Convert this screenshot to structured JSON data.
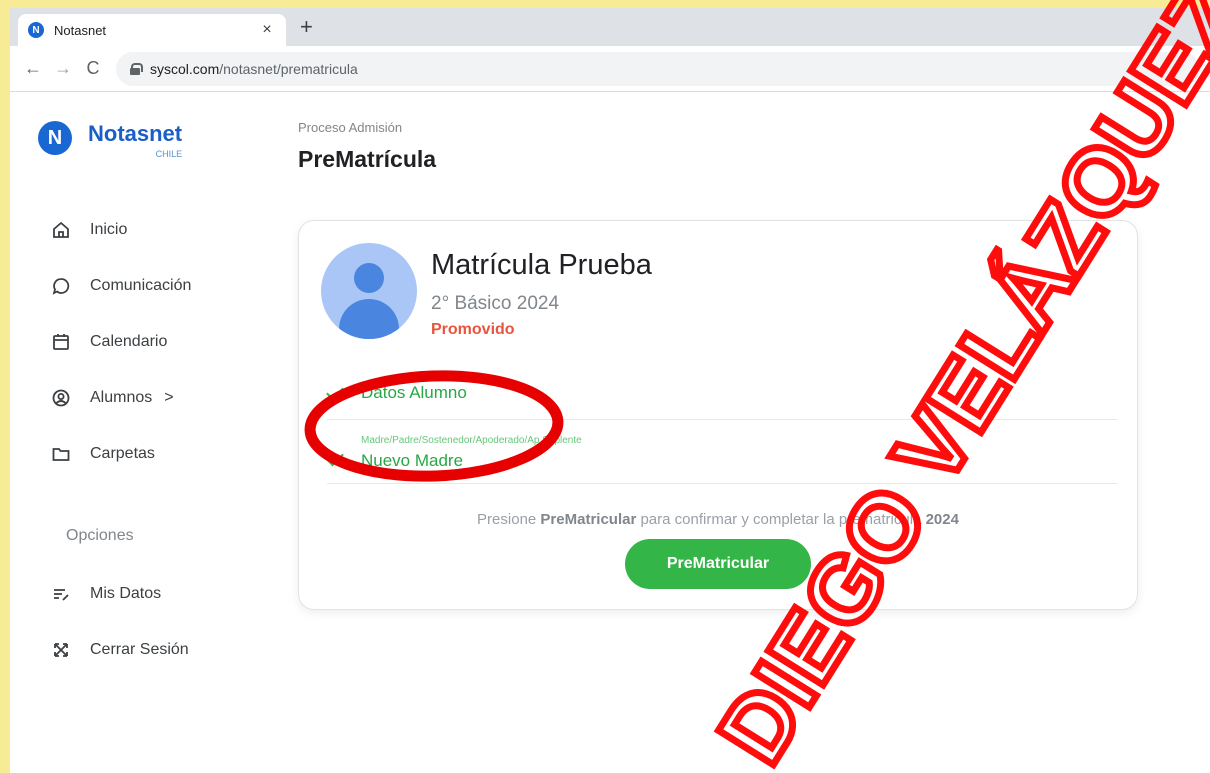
{
  "browser": {
    "tab_title": "Notasnet",
    "tab_close": "×",
    "new_tab": "+",
    "back": "←",
    "forward": "→",
    "reload": "C",
    "url_host": "syscol.com",
    "url_path": "/notasnet/prematricula"
  },
  "brand": {
    "logo_letter": "N",
    "name": "Notasnet",
    "country": "CHILE"
  },
  "sidebar": {
    "items": [
      {
        "label": "Inicio",
        "icon": "home-icon"
      },
      {
        "label": "Comunicación",
        "icon": "chat-bubble-icon"
      },
      {
        "label": "Calendario",
        "icon": "calendar-icon"
      },
      {
        "label": "Alumnos",
        "chevron": ">",
        "icon": "user-circle-icon"
      },
      {
        "label": "Carpetas",
        "icon": "folder-icon"
      }
    ],
    "section_label": "Opciones",
    "options": [
      {
        "label": "Mis Datos",
        "icon": "edit-list-icon"
      },
      {
        "label": "Cerrar Sesión",
        "icon": "logout-icon"
      }
    ]
  },
  "page": {
    "breadcrumb": "Proceso Admisión",
    "title": "PreMatrícula"
  },
  "card": {
    "student_name": "Matrícula Prueba",
    "grade": "2° Básico 2024",
    "status": "Promovido",
    "steps": [
      {
        "sublabel": "",
        "label": "Datos Alumno",
        "done": true
      },
      {
        "sublabel": "Madre/Padre/Sostenedor/Apoderado/Ap.Suplente",
        "label": "Nuevo Madre",
        "done": true
      }
    ],
    "hint_prefix": "Presione ",
    "hint_bold": "PreMatricular",
    "hint_middle": " para confirmar y completar la prematricula ",
    "hint_year": "2024",
    "button_label": "PreMatricular"
  },
  "colors": {
    "accent_blue": "#1a5fc8",
    "success_green": "#34b548",
    "status_red": "#e8553e",
    "annotation_red": "#e60000",
    "page_border_yellow": "#f7ec95"
  },
  "watermark": {
    "text": "DIEGO VELÁZQUEZ"
  }
}
